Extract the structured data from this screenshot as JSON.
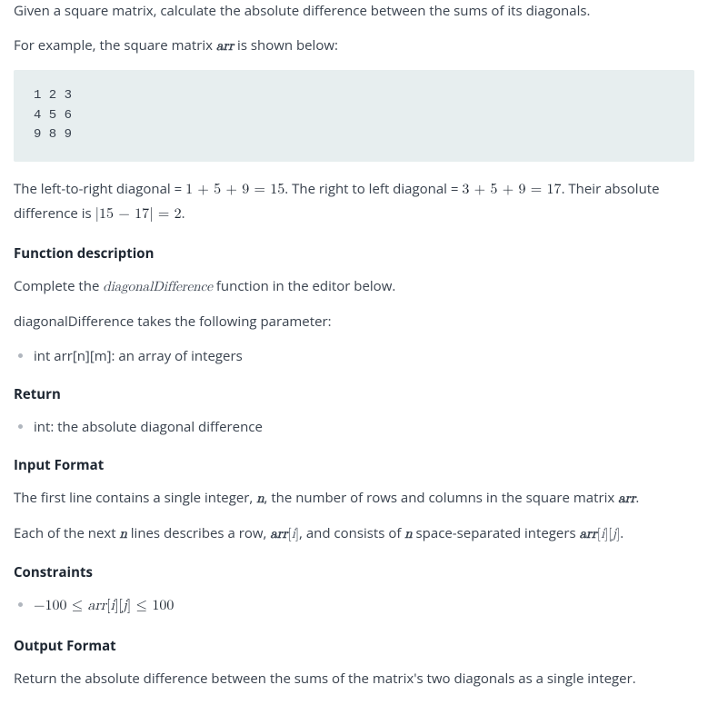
{
  "intro": {
    "p1": "Given a square matrix, calculate the absolute difference between the sums of its diagonals.",
    "p2_a": "For example, the square matrix ",
    "p2_arr": "arr",
    "p2_b": " is shown below:"
  },
  "code_example": "1 2 3\n4 5 6\n9 8 9",
  "diag": {
    "a": "The left-to-right diagonal = ",
    "eq1": "1 + 5 + 9 = 15",
    "b": ". The right to left diagonal = ",
    "eq2": "3 + 5 + 9 = 17",
    "c": ". Their absolute difference is ",
    "eq3": "|15 − 17| = 2",
    "d": "."
  },
  "fd": {
    "heading": "Function description",
    "p_a": "Complete the ",
    "fn": "diagonalDifference",
    "p_b": " function in the editor below.",
    "params_intro": "diagonalDifference takes the following parameter:",
    "param1": "int arr[n][m]: an array of integers"
  },
  "ret": {
    "heading": "Return",
    "item1": "int: the absolute diagonal difference"
  },
  "input": {
    "heading": "Input Format",
    "l1_a": "The first line contains a single integer, ",
    "n": "n",
    "l1_b": ", the number of rows and columns in the square matrix ",
    "arr": "arr",
    "l1_c": ".",
    "l2_a": "Each of the next ",
    "l2_b": " lines describes a row, ",
    "arri": "arr[i]",
    "l2_c": ", and consists of ",
    "l2_d": " space-separated integers ",
    "arrij": "arr[i][j]",
    "l2_e": "."
  },
  "constraints": {
    "heading": "Constraints",
    "c1_a": "−100 ≤ ",
    "c1_var": "arr",
    "c1_idx": "[i][j]",
    "c1_b": " ≤ 100"
  },
  "output": {
    "heading": "Output Format",
    "p": "Return the absolute difference between the sums of the matrix's two diagonals as a single integer."
  }
}
